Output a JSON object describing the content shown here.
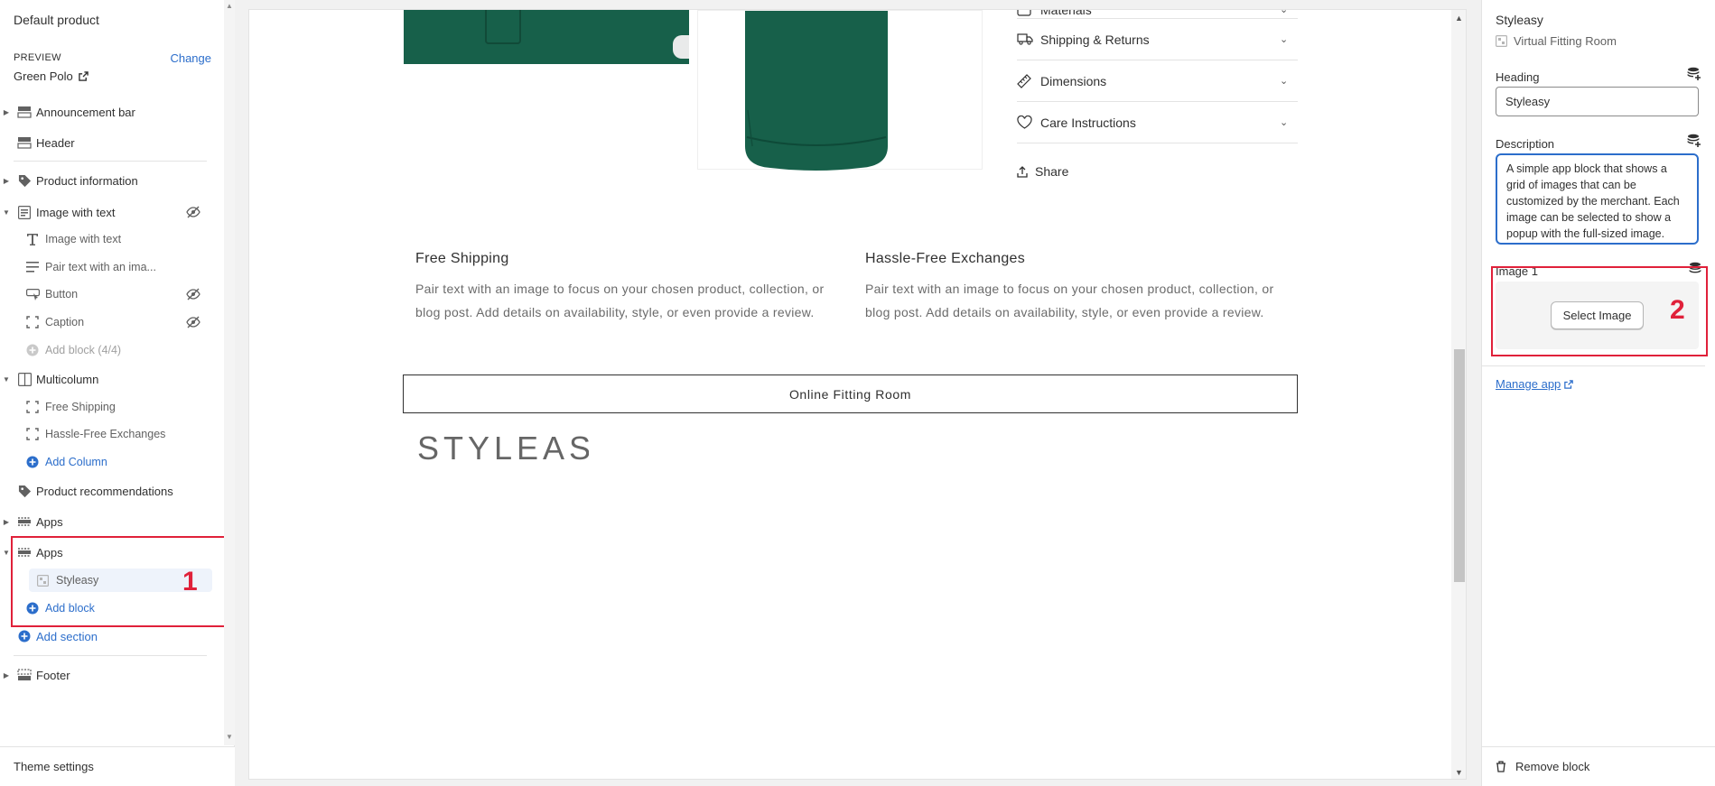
{
  "left": {
    "title": "Default product",
    "preview_label": "PREVIEW",
    "change_label": "Change",
    "preview_value": "Green Polo",
    "sections": {
      "announcement": "Announcement bar",
      "header": "Header",
      "product_info": "Product information",
      "image_with_text": "Image with text",
      "iwt_children": [
        "Image with text",
        "Pair text with an ima...",
        "Button",
        "Caption"
      ],
      "iwt_add": "Add block (4/4)",
      "multicolumn": "Multicolumn",
      "mc_children": [
        "Free Shipping",
        "Hassle-Free Exchanges"
      ],
      "mc_add": "Add Column",
      "recommendations": "Product recommendations",
      "apps1": "Apps",
      "apps2": "Apps",
      "apps2_child": "Styleasy",
      "apps2_add": "Add block",
      "add_section": "Add section",
      "footer": "Footer"
    },
    "highlight_number": "1",
    "theme_settings": "Theme settings"
  },
  "canvas": {
    "accordion": [
      "Materials",
      "Shipping & Returns",
      "Dimensions",
      "Care Instructions"
    ],
    "share": "Share",
    "col1_title": "Free Shipping",
    "col1_text": "Pair text with an image to focus on your chosen product, collection, or blog post. Add details on availability, style, or even provide a review.",
    "col2_title": "Hassle-Free Exchanges",
    "col2_text": "Pair text with an image to focus on your chosen product, collection, or blog post. Add details on availability, style, or even provide a review.",
    "fitting_button": "Online Fitting Room",
    "logo_text": "STYLEASY",
    "colors": {
      "shirt": "#17604a"
    }
  },
  "right": {
    "title": "Styleasy",
    "subtitle": "Virtual Fitting Room",
    "heading_label": "Heading",
    "heading_value": "Styleasy",
    "description_label": "Description",
    "description_value": "A simple app block that shows a grid of images that can be customized by the merchant. Each image can be selected to show a popup with the full-sized image.",
    "image_label": "Image 1",
    "select_image": "Select Image",
    "highlight_number": "2",
    "manage_app": "Manage app",
    "remove_block": "Remove block"
  },
  "accent": "#2c6ecb",
  "highlight_color": "#e0213a"
}
